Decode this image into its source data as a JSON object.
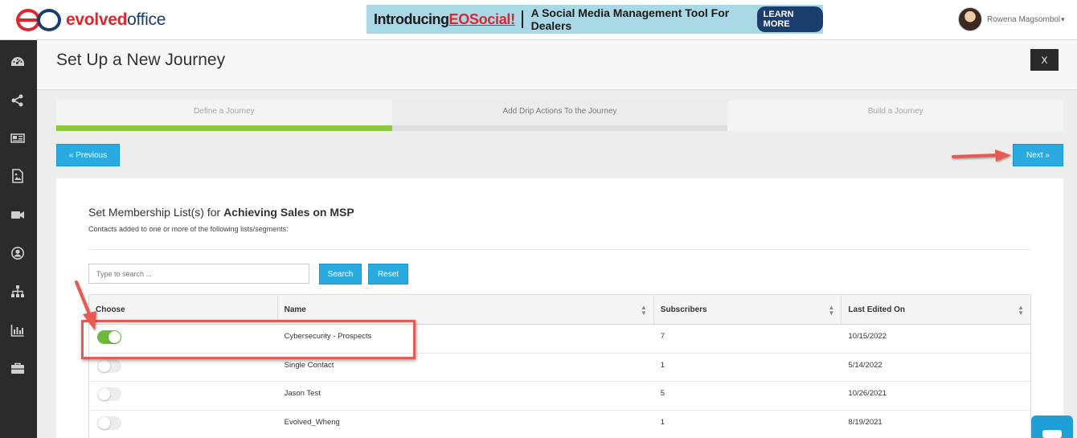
{
  "brand": {
    "name_part1": "evolved",
    "name_part2": "office"
  },
  "banner": {
    "intro": "Introducing",
    "brand": "EOSocial!",
    "tagline": "A Social Media Management Tool For Dealers",
    "cta": "LEARN MORE"
  },
  "user": {
    "name": "Rowena Magsombol",
    "caret": "▾"
  },
  "sidebar": {
    "items": [
      {
        "icon": "dashboard-icon"
      },
      {
        "icon": "share-icon"
      },
      {
        "icon": "newspaper-icon"
      },
      {
        "icon": "image-file-icon"
      },
      {
        "icon": "video-camera-icon"
      },
      {
        "icon": "user-circle-icon"
      },
      {
        "icon": "sitemap-icon"
      },
      {
        "icon": "bar-chart-icon"
      },
      {
        "icon": "briefcase-icon"
      }
    ]
  },
  "header": {
    "title": "Set Up a New Journey",
    "close_label": "X"
  },
  "steps": [
    {
      "label": "Define a Journey",
      "state": "done"
    },
    {
      "label": "Add Drip Actions To the Journey",
      "state": "active"
    },
    {
      "label": "Build a Journey",
      "state": "pending"
    }
  ],
  "nav": {
    "previous": "« Previous",
    "next": "Next »"
  },
  "panel": {
    "title_prefix": "Set Membership List(s) for ",
    "title_name": "Achieving Sales on MSP",
    "subtitle": "Contacts added to one or more of the following lists/segments:",
    "search_placeholder": "Type to search ...",
    "search_label": "Search",
    "reset_label": "Reset"
  },
  "table": {
    "columns": [
      "Choose",
      "Name",
      "Subscribers",
      "Last Edited On"
    ],
    "rows": [
      {
        "selected": true,
        "name": "Cybersecurity - Prospects",
        "subscribers": "7",
        "edited": "10/15/2022"
      },
      {
        "selected": false,
        "name": "Single Contact",
        "subscribers": "1",
        "edited": "5/14/2022"
      },
      {
        "selected": false,
        "name": "Jason Test",
        "subscribers": "5",
        "edited": "10/26/2021"
      },
      {
        "selected": false,
        "name": "Evolved_Wheng",
        "subscribers": "1",
        "edited": "8/19/2021"
      }
    ]
  },
  "colors": {
    "accent": "#29abe2",
    "progress": "#8dc63f",
    "toggle_on": "#6cbb3c",
    "annotation": "#e85a4f",
    "sidebar": "#2b2b2b"
  }
}
